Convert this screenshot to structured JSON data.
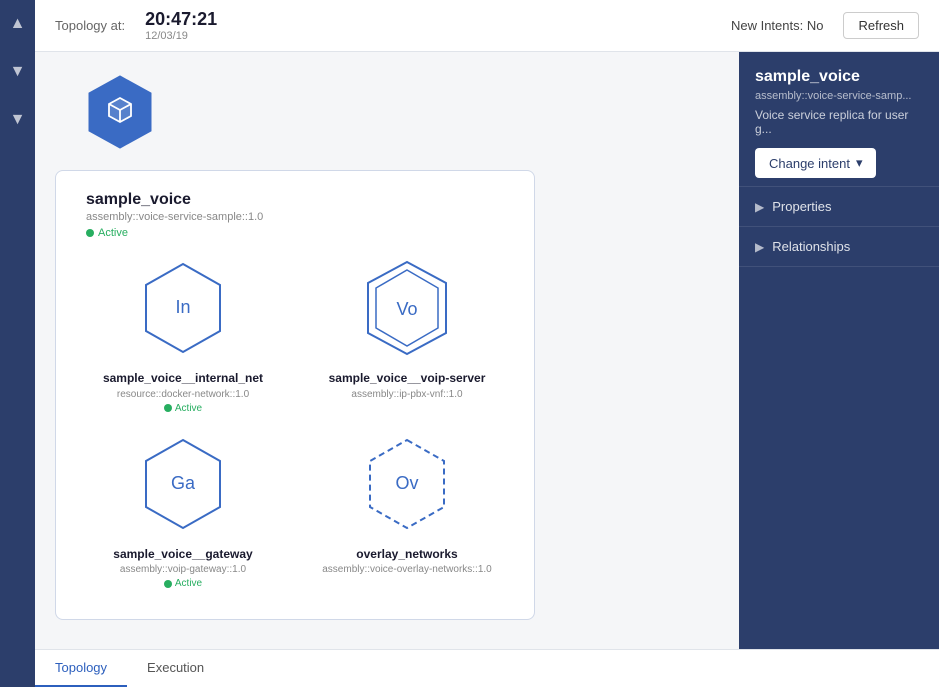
{
  "topbar": {
    "topology_label": "Topology at:",
    "time": "20:47:21",
    "date": "12/03/19",
    "new_intents_label": "New Intents: No",
    "refresh_label": "Refresh"
  },
  "main_node": {
    "name": "sample_voice",
    "type": "assembly::voice-service-sample::1.0",
    "status": "Active"
  },
  "children": [
    {
      "label": "In",
      "name": "sample_voice__internal_net",
      "type": "resource::docker-network::1.0",
      "status": "Active",
      "style": "solid"
    },
    {
      "label": "Vo",
      "name": "sample_voice__voip-server",
      "type": "assembly::ip-pbx-vnf::1.0",
      "status": null,
      "style": "double"
    },
    {
      "label": "Ga",
      "name": "sample_voice__gateway",
      "type": "assembly::voip-gateway::1.0",
      "status": "Active",
      "style": "solid"
    },
    {
      "label": "Ov",
      "name": "overlay_networks",
      "type": "assembly::voice-overlay-networks::1.0",
      "status": null,
      "style": "dashed"
    }
  ],
  "right_panel": {
    "title": "sample_voice",
    "subtitle": "assembly::voice-service-samp...",
    "description": "Voice service replica for user g...",
    "change_intent_label": "Change intent",
    "sections": [
      {
        "label": "Properties"
      },
      {
        "label": "Relationships"
      }
    ]
  },
  "bottom_tabs": [
    {
      "label": "Topology",
      "active": true
    },
    {
      "label": "Execution",
      "active": false
    }
  ],
  "sidebar_icons": [
    "▲",
    "▼",
    "▼"
  ]
}
